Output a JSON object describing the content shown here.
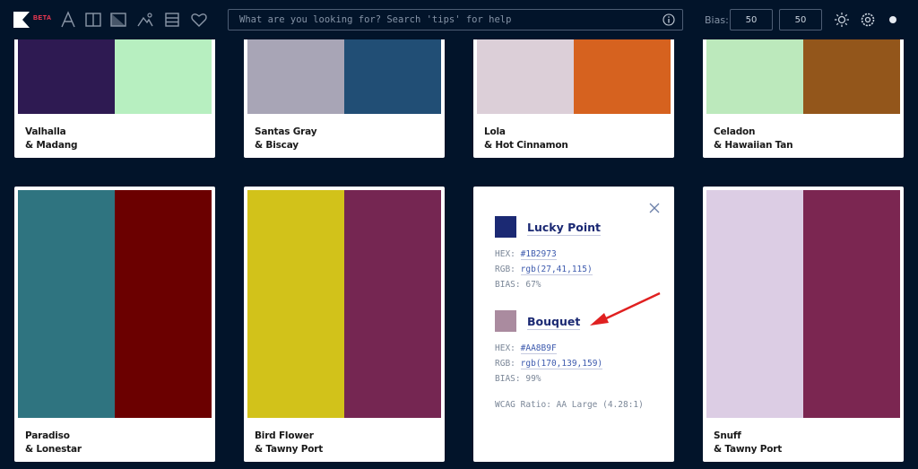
{
  "toolbar": {
    "beta_label": "BETA",
    "icons": [
      "logo-icon",
      "font-icon",
      "columns-icon",
      "gradient-icon",
      "image-icon",
      "list-icon",
      "heart-icon"
    ],
    "search_placeholder": "What are you looking for? Search 'tips' for help",
    "bias_label": "Bias:",
    "bias_value_1": "50",
    "bias_value_2": "50",
    "right_icons": [
      "sun-icon",
      "settings-icon",
      "dot-icon"
    ]
  },
  "pairs": [
    {
      "name1": "Valhalla",
      "name2": "& Madang",
      "color1": "#2e1a52",
      "color2": "#b7efc0"
    },
    {
      "name1": "Santas Gray",
      "name2": "& Biscay",
      "color1": "#a8a5b6",
      "color2": "#214e75"
    },
    {
      "name1": "Lola",
      "name2": "& Hot Cinnamon",
      "color1": "#dccfd8",
      "color2": "#d6621f"
    },
    {
      "name1": "Celadon",
      "name2": "& Hawaiian Tan",
      "color1": "#bce9bc",
      "color2": "#93561b"
    },
    {
      "name1": "Paradiso",
      "name2": "& Lonestar",
      "color1": "#2f7480",
      "color2": "#6b0000"
    },
    {
      "name1": "Bird Flower",
      "name2": "& Tawny Port",
      "color1": "#d2c21a",
      "color2": "#752652"
    },
    {
      "name1": "Snuff",
      "name2": "& Tawny Port",
      "color1": "#dccde4",
      "color2": "#7b2651"
    }
  ],
  "detail": {
    "color1": {
      "name": "Lucky Point",
      "swatch": "#1b2973",
      "hex_label": "HEX:",
      "hex": "#1B2973",
      "rgb_label": "RGB:",
      "rgb": "rgb(27,41,115)",
      "bias_label": "BIAS:",
      "bias": "67%"
    },
    "color2": {
      "name": "Bouquet",
      "swatch": "#aa8b9f",
      "hex_label": "HEX:",
      "hex": "#AA8B9F",
      "rgb_label": "RGB:",
      "rgb": "rgb(170,139,159)",
      "bias_label": "BIAS:",
      "bias": "99%"
    },
    "wcag": "WCAG Ratio: AA Large (4.28:1)"
  },
  "colors": {
    "background": "#02142a",
    "arrow": "#e02020",
    "beta": "#ff3b55"
  }
}
